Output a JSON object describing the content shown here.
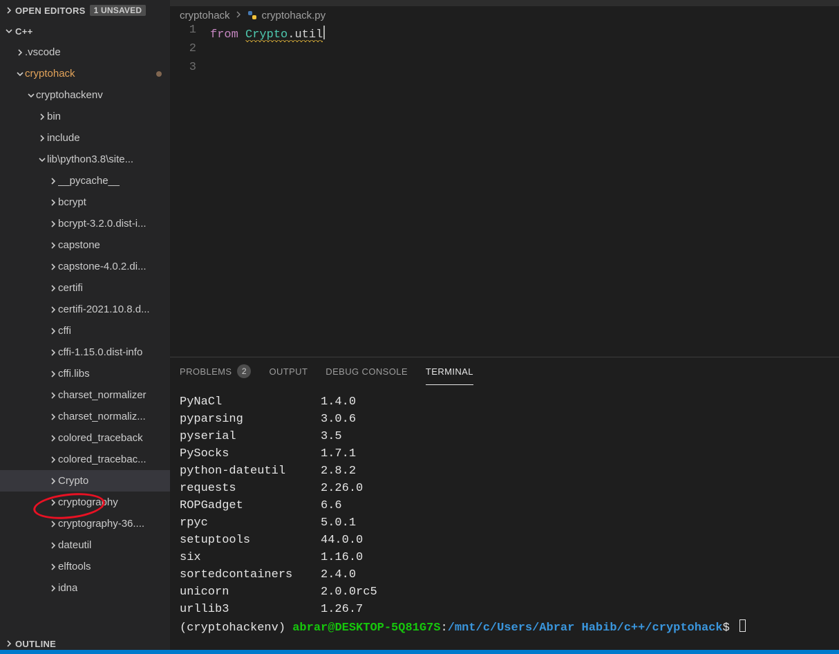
{
  "sidebar": {
    "openEditors": {
      "label": "OPEN EDITORS",
      "badge": "1 UNSAVED"
    },
    "workspace": {
      "label": "C++"
    },
    "tree": [
      {
        "label": ".vscode",
        "depth": 1,
        "chev": "right",
        "selected": false,
        "orange": false,
        "dot": false
      },
      {
        "label": "cryptohack",
        "depth": 1,
        "chev": "down",
        "selected": false,
        "orange": true,
        "dot": true
      },
      {
        "label": "cryptohackenv",
        "depth": 2,
        "chev": "down",
        "selected": false,
        "orange": false,
        "dot": false
      },
      {
        "label": "bin",
        "depth": 3,
        "chev": "right",
        "selected": false,
        "orange": false,
        "dot": false
      },
      {
        "label": "include",
        "depth": 3,
        "chev": "right",
        "selected": false,
        "orange": false,
        "dot": false
      },
      {
        "label": "lib\\python3.8\\site...",
        "depth": 3,
        "chev": "down",
        "selected": false,
        "orange": false,
        "dot": false
      },
      {
        "label": "__pycache__",
        "depth": 4,
        "chev": "right",
        "selected": false,
        "orange": false,
        "dot": false
      },
      {
        "label": "bcrypt",
        "depth": 4,
        "chev": "right",
        "selected": false,
        "orange": false,
        "dot": false
      },
      {
        "label": "bcrypt-3.2.0.dist-i...",
        "depth": 4,
        "chev": "right",
        "selected": false,
        "orange": false,
        "dot": false
      },
      {
        "label": "capstone",
        "depth": 4,
        "chev": "right",
        "selected": false,
        "orange": false,
        "dot": false
      },
      {
        "label": "capstone-4.0.2.di...",
        "depth": 4,
        "chev": "right",
        "selected": false,
        "orange": false,
        "dot": false
      },
      {
        "label": "certifi",
        "depth": 4,
        "chev": "right",
        "selected": false,
        "orange": false,
        "dot": false
      },
      {
        "label": "certifi-2021.10.8.d...",
        "depth": 4,
        "chev": "right",
        "selected": false,
        "orange": false,
        "dot": false
      },
      {
        "label": "cffi",
        "depth": 4,
        "chev": "right",
        "selected": false,
        "orange": false,
        "dot": false
      },
      {
        "label": "cffi-1.15.0.dist-info",
        "depth": 4,
        "chev": "right",
        "selected": false,
        "orange": false,
        "dot": false
      },
      {
        "label": "cffi.libs",
        "depth": 4,
        "chev": "right",
        "selected": false,
        "orange": false,
        "dot": false
      },
      {
        "label": "charset_normalizer",
        "depth": 4,
        "chev": "right",
        "selected": false,
        "orange": false,
        "dot": false
      },
      {
        "label": "charset_normaliz...",
        "depth": 4,
        "chev": "right",
        "selected": false,
        "orange": false,
        "dot": false
      },
      {
        "label": "colored_traceback",
        "depth": 4,
        "chev": "right",
        "selected": false,
        "orange": false,
        "dot": false
      },
      {
        "label": "colored_tracebac...",
        "depth": 4,
        "chev": "right",
        "selected": false,
        "orange": false,
        "dot": false
      },
      {
        "label": "Crypto",
        "depth": 4,
        "chev": "right",
        "selected": true,
        "orange": false,
        "dot": false
      },
      {
        "label": "cryptography",
        "depth": 4,
        "chev": "right",
        "selected": false,
        "orange": false,
        "dot": false
      },
      {
        "label": "cryptography-36....",
        "depth": 4,
        "chev": "right",
        "selected": false,
        "orange": false,
        "dot": false
      },
      {
        "label": "dateutil",
        "depth": 4,
        "chev": "right",
        "selected": false,
        "orange": false,
        "dot": false
      },
      {
        "label": "elftools",
        "depth": 4,
        "chev": "right",
        "selected": false,
        "orange": false,
        "dot": false
      },
      {
        "label": "idna",
        "depth": 4,
        "chev": "right",
        "selected": false,
        "orange": false,
        "dot": false
      }
    ],
    "outline": {
      "label": "OUTLINE"
    }
  },
  "breadcrumb": {
    "part1": "cryptohack",
    "part2": "cryptohack.py"
  },
  "editor": {
    "lines": [
      {
        "num": "1",
        "kw": "from",
        "mod": "Crypto",
        "dot": ".",
        "sub": "util"
      },
      {
        "num": "2"
      },
      {
        "num": "3"
      }
    ]
  },
  "panel": {
    "tabs": {
      "problems": "PROBLEMS",
      "problemsCount": "2",
      "output": "OUTPUT",
      "debugConsole": "DEBUG CONSOLE",
      "terminal": "TERMINAL"
    },
    "terminal": {
      "rows": [
        {
          "name": "PyNaCl",
          "ver": "1.4.0"
        },
        {
          "name": "pyparsing",
          "ver": "3.0.6"
        },
        {
          "name": "pyserial",
          "ver": "3.5"
        },
        {
          "name": "PySocks",
          "ver": "1.7.1"
        },
        {
          "name": "python-dateutil",
          "ver": "2.8.2"
        },
        {
          "name": "requests",
          "ver": "2.26.0"
        },
        {
          "name": "ROPGadget",
          "ver": "6.6"
        },
        {
          "name": "rpyc",
          "ver": "5.0.1"
        },
        {
          "name": "setuptools",
          "ver": "44.0.0"
        },
        {
          "name": "six",
          "ver": "1.16.0"
        },
        {
          "name": "sortedcontainers",
          "ver": "2.4.0"
        },
        {
          "name": "unicorn",
          "ver": "2.0.0rc5"
        },
        {
          "name": "urllib3",
          "ver": "1.26.7"
        }
      ],
      "prompt": {
        "venv": "(cryptohackenv) ",
        "user": "abrar@DESKTOP-5Q81G7S",
        "colon": ":",
        "cwd": "/mnt/c/Users/Abrar Habib/c++/cryptohack",
        "dollar": "$ "
      }
    }
  }
}
